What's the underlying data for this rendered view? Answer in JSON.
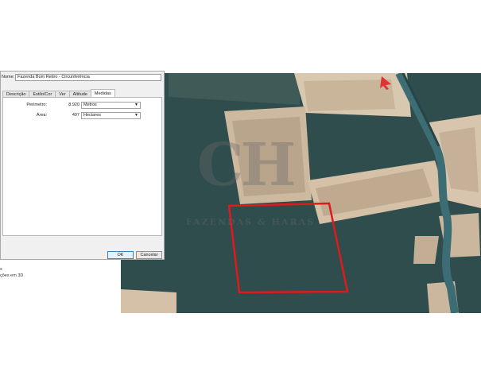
{
  "dialog": {
    "name_label": "Nome:",
    "name_value": "Fazenda Bom Retiro - Circunferência",
    "tabs": [
      {
        "label": "Descrição",
        "active": false
      },
      {
        "label": "Estilo/Cor",
        "active": false
      },
      {
        "label": "Ver",
        "active": false
      },
      {
        "label": "Altitude",
        "active": false
      },
      {
        "label": "Medidas",
        "active": true
      }
    ],
    "measures": {
      "perimeter_label": "Perímetro:",
      "perimeter_value": "8.920",
      "perimeter_unit": "Metros",
      "area_label": "Área:",
      "area_value": "497",
      "area_unit": "Hectares"
    },
    "ok_label": "OK",
    "cancel_label": "Cancelar"
  },
  "sidebar_fragments": {
    "line1": "s",
    "line2": "ções em 3D"
  },
  "watermark": {
    "text": "FAZENDAS & HARAS"
  },
  "colors": {
    "polygon_outline": "#e0191c",
    "field_water": "#2f4d4c",
    "field_bare": "#d9c8b0",
    "river": "#3d6d74"
  },
  "icons": {
    "select_arrow": "chevron-down-icon",
    "map_marker": "arrow-marker-icon"
  }
}
